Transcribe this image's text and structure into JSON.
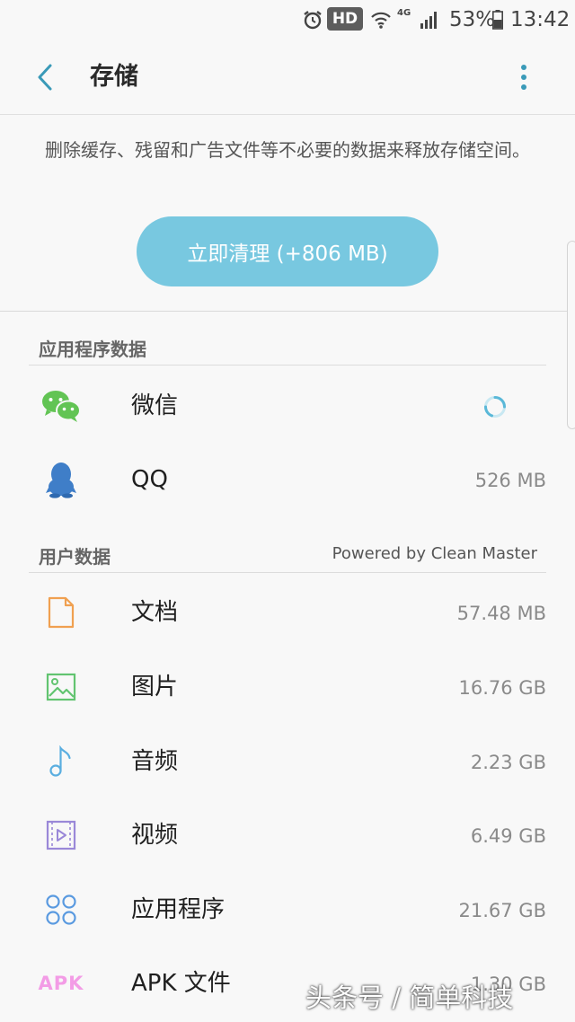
{
  "status_bar": {
    "hd": "HD",
    "network": "4G",
    "battery_percent": "53%",
    "time": "13:42"
  },
  "header": {
    "title": "存储"
  },
  "description": "删除缓存、残留和广告文件等不必要的数据来释放存储空间。",
  "clean_button": "立即清理 (+806 MB)",
  "app_data": {
    "title": "应用程序数据",
    "items": [
      {
        "label": "微信",
        "icon": "wechat-icon",
        "size": ""
      },
      {
        "label": "QQ",
        "icon": "qq-penguin-icon",
        "size": "526 MB"
      }
    ]
  },
  "user_data": {
    "title": "用户数据",
    "powered_by": "Powered by Clean Master",
    "items": [
      {
        "label": "文档",
        "icon": "document-icon",
        "size": "57.48 MB"
      },
      {
        "label": "图片",
        "icon": "image-icon",
        "size": "16.76 GB"
      },
      {
        "label": "音频",
        "icon": "music-note-icon",
        "size": "2.23 GB"
      },
      {
        "label": "视频",
        "icon": "video-icon",
        "size": "6.49 GB"
      },
      {
        "label": "应用程序",
        "icon": "apps-grid-icon",
        "size": "21.67 GB"
      },
      {
        "label": "APK 文件",
        "icon": "apk-icon",
        "icon_text": "APK",
        "size": "1.30 GB"
      }
    ]
  },
  "watermark": "头条号 / 简单科技",
  "colors": {
    "accent": "#78c8e0",
    "back_arrow": "#3a9ab8",
    "wechat": "#62c454",
    "qq": "#3f7ec8",
    "document": "#f0a050",
    "image": "#62c470",
    "audio": "#5aaee0",
    "video": "#9a88d8",
    "apps": "#5a9ae0",
    "apk": "#f39ce6"
  }
}
